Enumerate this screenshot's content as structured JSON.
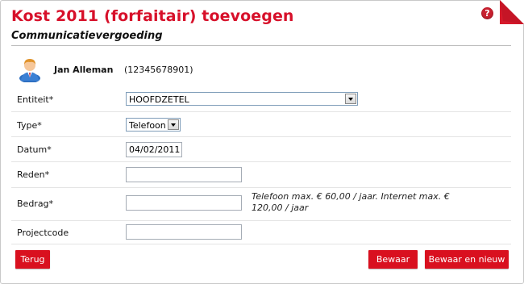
{
  "header": {
    "title": "Kost 2011 (forfaitair) toevoegen",
    "subtitle": "Communicatievergoeding",
    "help_icon_glyph": "?"
  },
  "user": {
    "name": "Jan Alleman",
    "id": "(12345678901)",
    "icon": "user-avatar-icon"
  },
  "form": {
    "entiteit": {
      "label": "Entiteit*",
      "value": "HOOFDZETEL"
    },
    "type": {
      "label": "Type*",
      "value": "Telefoon"
    },
    "datum": {
      "label": "Datum*",
      "value": "04/02/2011"
    },
    "reden": {
      "label": "Reden*",
      "value": ""
    },
    "bedrag": {
      "label": "Bedrag*",
      "value": "",
      "hint_line1": "Telefoon max. € 60,00 / jaar. Internet max. €",
      "hint_line2": "120,00 / jaar"
    },
    "projectcode": {
      "label": "Projectcode",
      "value": ""
    }
  },
  "buttons": {
    "back": "Terug",
    "save": "Bewaar",
    "save_new": "Bewaar en nieuw"
  },
  "colors": {
    "accent": "#d7102a",
    "button": "#d9101f",
    "help_icon": "#c8202f"
  }
}
